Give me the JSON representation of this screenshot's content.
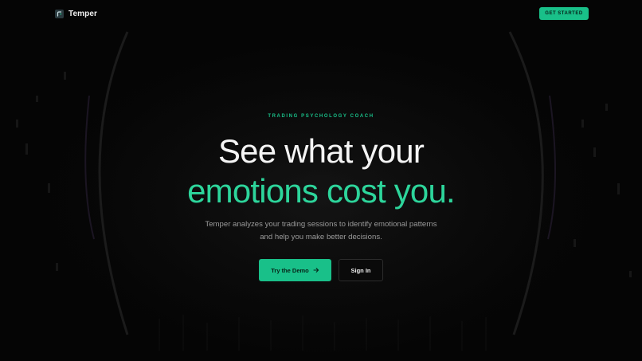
{
  "header": {
    "brand_name": "Temper",
    "brand_icon": "temper-logo-icon",
    "cta_label": "GET STARTED"
  },
  "hero": {
    "eyebrow": "TRADING PSYCHOLOGY COACH",
    "headline_line1": "See what your",
    "headline_line2": "emotions cost you.",
    "subtext": "Temper analyzes your trading sessions to identify emotional patterns and help you make better decisions.",
    "primary_button_label": "Try the Demo",
    "primary_button_icon": "arrow-right-icon",
    "secondary_button_label": "Sign In"
  },
  "colors": {
    "accent": "#19c089",
    "headline_accent": "#2dd59b",
    "background": "#050505",
    "muted_text": "#9a9a9a"
  }
}
